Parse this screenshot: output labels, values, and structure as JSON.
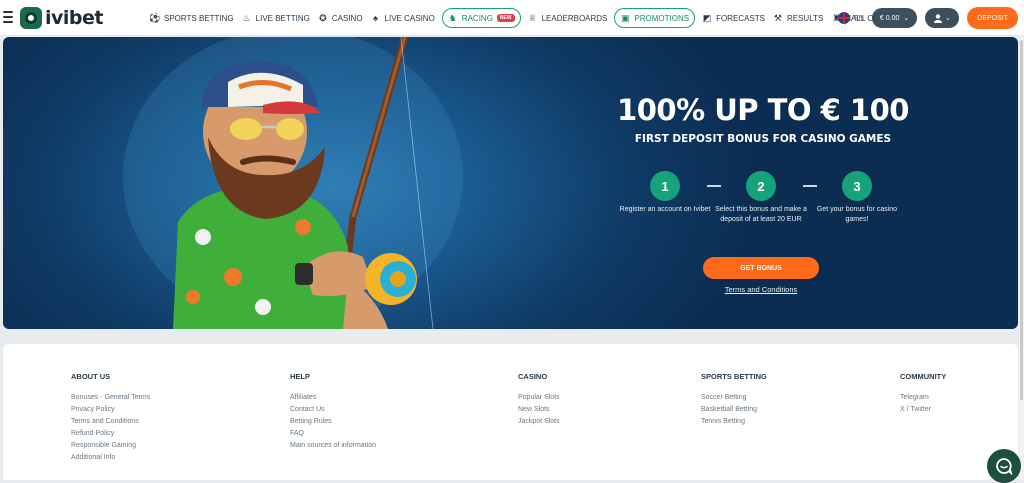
{
  "header": {
    "logo_text": "ivibet",
    "nav": [
      {
        "label": "SPORTS BETTING",
        "icon": "soccer-ball-icon"
      },
      {
        "label": "LIVE BETTING",
        "icon": "fire-icon"
      },
      {
        "label": "CASINO",
        "icon": "casino-chip-icon"
      },
      {
        "label": "LIVE CASINO",
        "icon": "cards-icon"
      },
      {
        "label": "RACING",
        "icon": "horse-icon",
        "badge": "NEW"
      },
      {
        "label": "LEADERBOARDS",
        "icon": "trophy-icon"
      },
      {
        "label": "PROMOTIONS",
        "icon": "gift-icon"
      },
      {
        "label": "FORECASTS",
        "icon": "chart-icon"
      },
      {
        "label": "RESULTS",
        "icon": "tools-icon"
      },
      {
        "label": "HALL OF FAME",
        "icon": "castle-icon"
      }
    ],
    "lang": "EN",
    "balance": "€ 0.00",
    "deposit_label": "DEPOSIT"
  },
  "banner": {
    "headline": "100% UP TO € 100",
    "subheadline": "FIRST DEPOSIT BONUS FOR CASINO GAMES",
    "steps": [
      {
        "num": "1",
        "text": "Register an account on Ivibet"
      },
      {
        "num": "2",
        "text": "Select this bonus and make a deposit of at least 20 EUR"
      },
      {
        "num": "3",
        "text": "Get your bonus for casino games!"
      }
    ],
    "cta": "GET BONUS",
    "terms": "Terms and Conditions"
  },
  "footer": {
    "columns": [
      {
        "title": "ABOUT US",
        "links": [
          "Bonuses - General Terms",
          "Privacy Policy",
          "Terms and Conditions",
          "Refund Policy",
          "Responsible Gaming",
          "Additional Info"
        ]
      },
      {
        "title": "HELP",
        "links": [
          "Affiliates",
          "Contact Us",
          "Betting Rules",
          "FAQ",
          "Main sources of information"
        ]
      },
      {
        "title": "CASINO",
        "links": [
          "Popular Slots",
          "New Slots",
          "Jackpot Slots"
        ]
      },
      {
        "title": "SPORTS BETTING",
        "links": [
          "Soccer Betting",
          "Basketball Betting",
          "Tennis Betting"
        ]
      },
      {
        "title": "COMMUNITY",
        "links": [
          "Telegram",
          "X / Twitter"
        ]
      }
    ]
  },
  "colors": {
    "accent_orange": "#ff6b1a",
    "accent_green": "#16a37c",
    "banner_blue": "#0f3b66"
  }
}
